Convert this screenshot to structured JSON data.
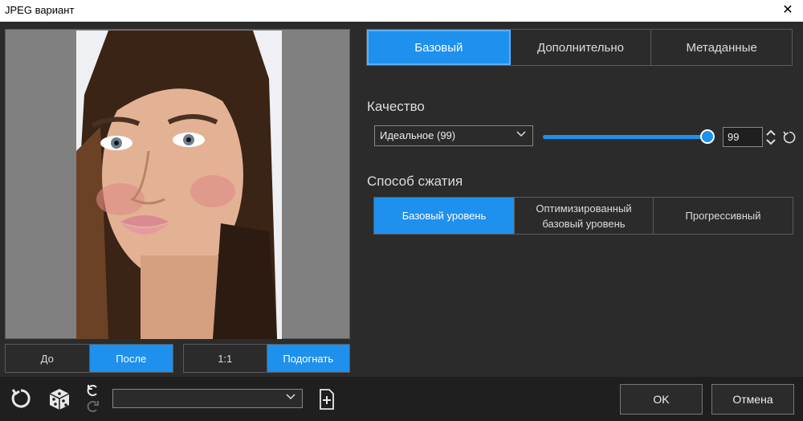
{
  "window": {
    "title": "JPEG вариант",
    "close_icon": "close-icon"
  },
  "preview": {
    "view_toggle": {
      "before_label": "До",
      "after_label": "После",
      "selected": "after"
    },
    "zoom_toggle": {
      "actual_label": "1:1",
      "fit_label": "Подогнать",
      "selected": "fit"
    }
  },
  "tabs": [
    {
      "label": "Базовый",
      "active": true
    },
    {
      "label": "Дополнительно",
      "active": false
    },
    {
      "label": "Метаданные",
      "active": false
    }
  ],
  "quality": {
    "label": "Качество",
    "preset_value": "Идеальное (99)",
    "value": "99",
    "slider_fraction": 0.99
  },
  "compression": {
    "label": "Способ сжатия",
    "options": [
      {
        "label": "Базовый уровень",
        "active": true
      },
      {
        "label": "Оптимизированный\nбазовый уровень",
        "active": false
      },
      {
        "label": "Прогрессивный",
        "active": false
      }
    ]
  },
  "bottom": {
    "preset_select_value": "",
    "ok_label": "OK",
    "cancel_label": "Отмена"
  },
  "colors": {
    "accent": "#1e90ee",
    "background": "#2b2b2b",
    "bottom_bar": "#1f1f1f"
  }
}
